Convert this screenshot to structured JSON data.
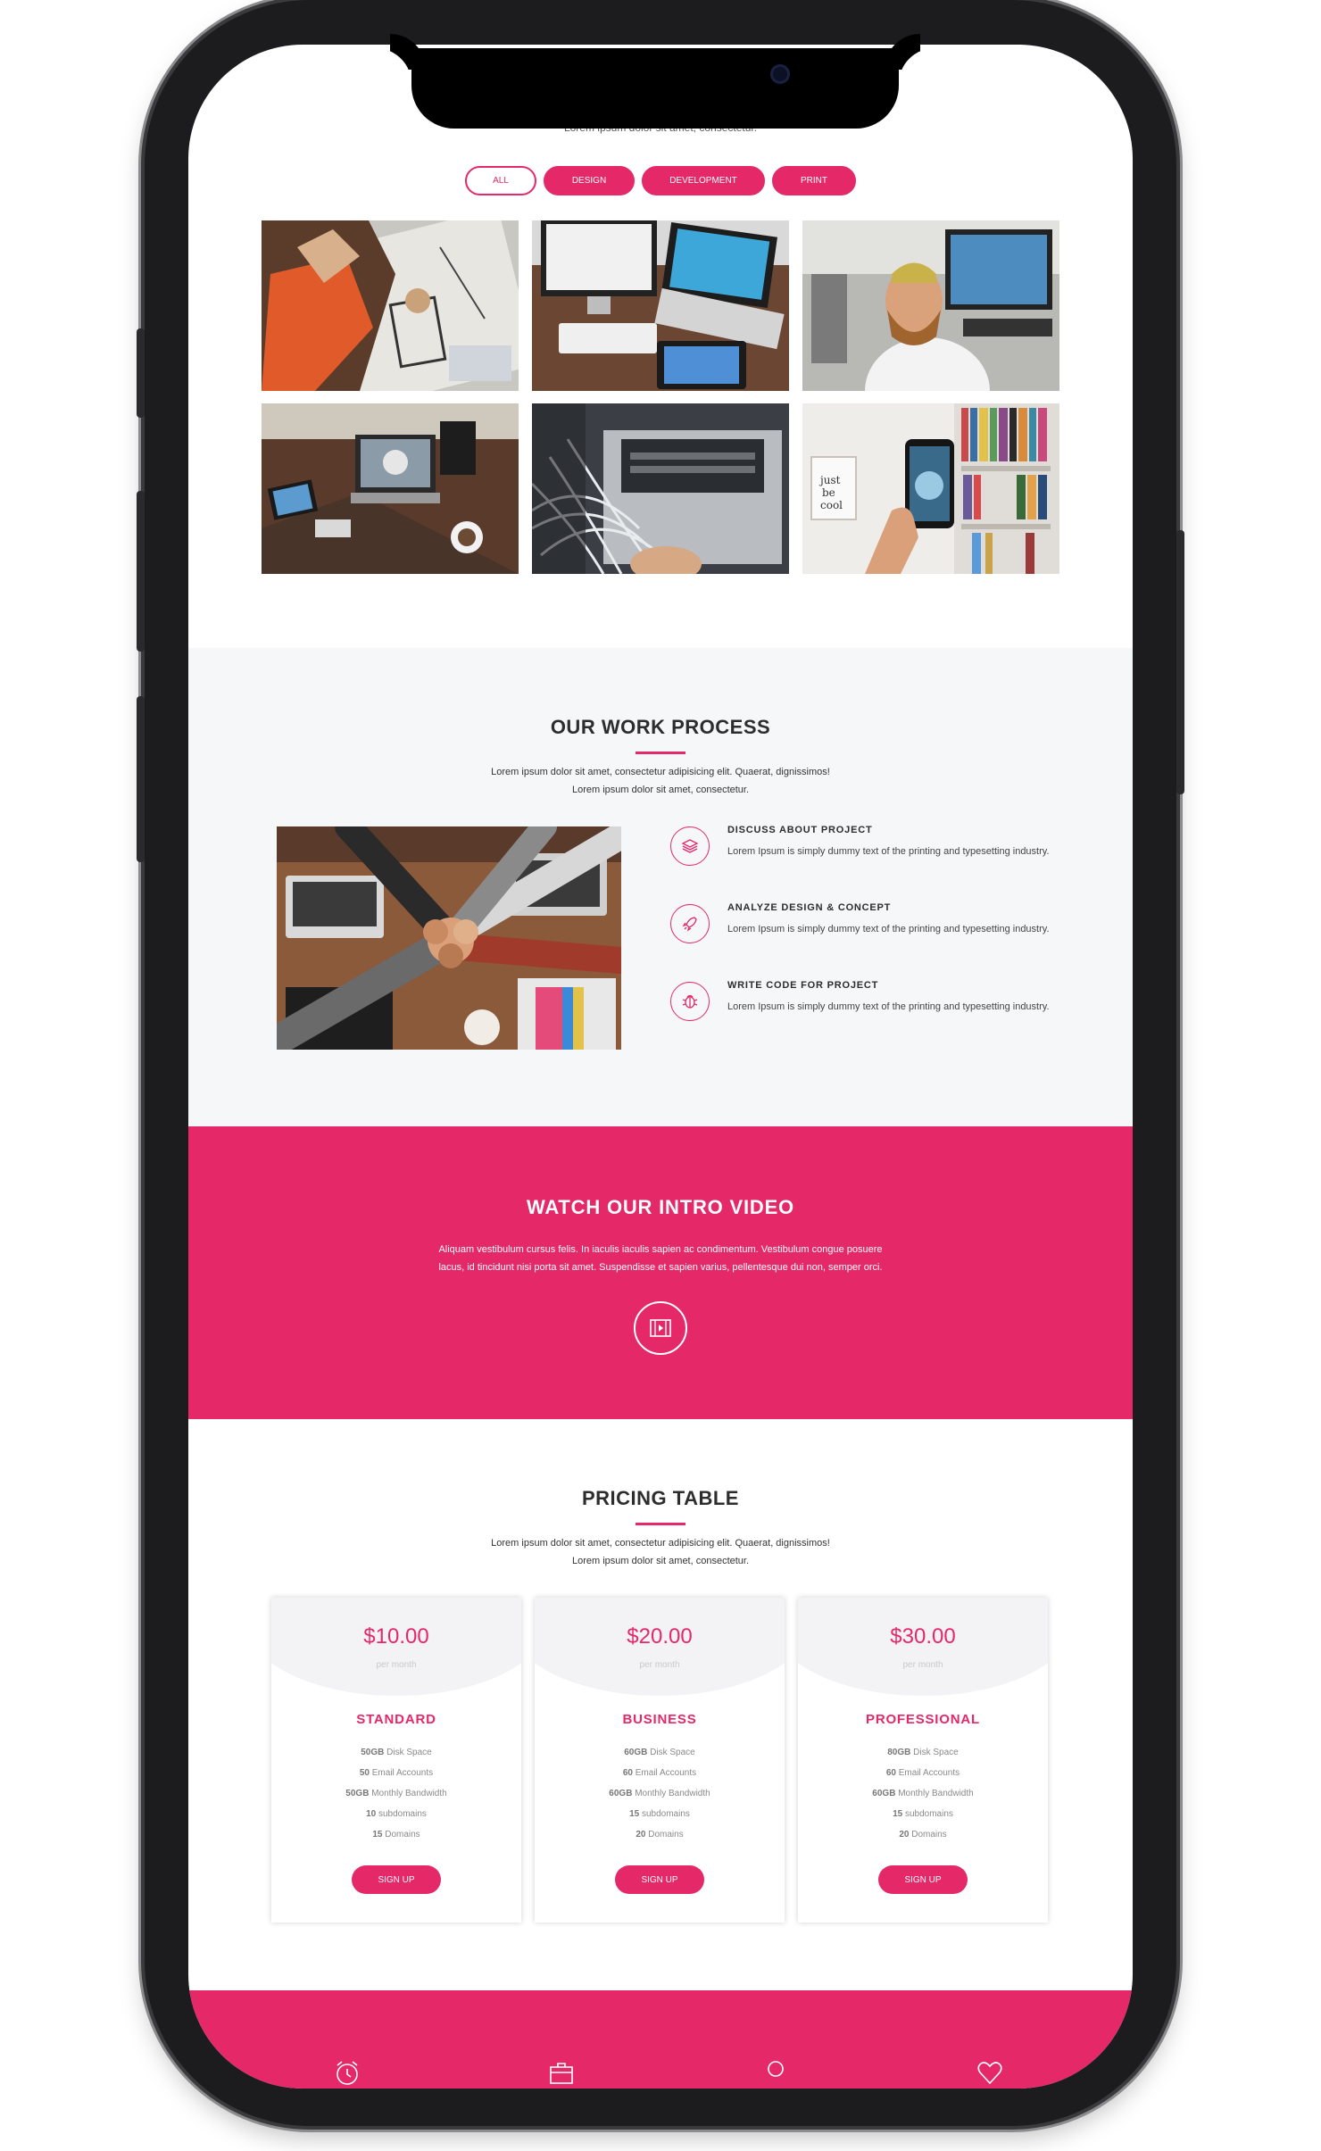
{
  "top": {
    "cut_text": "Lorem ipsum dolor sit amet, consectetur."
  },
  "filters": [
    {
      "label": "ALL",
      "active": true
    },
    {
      "label": "DESIGN",
      "active": false
    },
    {
      "label": "DEVELOPMENT",
      "active": false
    },
    {
      "label": "PRINT",
      "active": false
    }
  ],
  "gallery": [
    "designer-sketching",
    "imac-keyboard-tablet",
    "smiling-man-office",
    "desk-laptop-gadgets",
    "network-cables-server",
    "hand-holding-phone"
  ],
  "process": {
    "title": "OUR WORK PROCESS",
    "lead_line1": "Lorem ipsum dolor sit amet, consectetur adipisicing elit. Quaerat, dignissimos!",
    "lead_line2": "Lorem ipsum dolor sit amet, consectetur.",
    "steps": [
      {
        "icon": "layers-icon",
        "title": "DISCUSS ABOUT PROJECT",
        "desc": "Lorem Ipsum is simply dummy text of the printing and typesetting industry."
      },
      {
        "icon": "rocket-icon",
        "title": "ANALYZE DESIGN & CONCEPT",
        "desc": "Lorem Ipsum is simply dummy text of the printing and typesetting industry."
      },
      {
        "icon": "bug-icon",
        "title": "WRITE CODE FOR PROJECT",
        "desc": "Lorem Ipsum is simply dummy text of the printing and typesetting industry."
      }
    ]
  },
  "video": {
    "title": "WATCH OUR INTRO VIDEO",
    "line1": "Aliquam vestibulum cursus felis. In iaculis iaculis sapien ac condimentum. Vestibulum congue posuere",
    "line2": "lacus, id tincidunt nisi porta sit amet. Suspendisse et sapien varius, pellentesque dui non, semper orci."
  },
  "pricing": {
    "title": "PRICING TABLE",
    "lead_line1": "Lorem ipsum dolor sit amet, consectetur adipisicing elit. Quaerat, dignissimos!",
    "lead_line2": "Lorem ipsum dolor sit amet, consectetur.",
    "per": "per month",
    "signup": "SIGN UP",
    "plans": [
      {
        "price": "$10.00",
        "name": "STANDARD",
        "f1n": "50GB",
        "f1t": "Disk Space",
        "f2n": "50",
        "f2t": "Email Accounts",
        "f3n": "50GB",
        "f3t": "Monthly Bandwidth",
        "f4n": "10",
        "f4t": "subdomains",
        "f5n": "15",
        "f5t": "Domains"
      },
      {
        "price": "$20.00",
        "name": "BUSINESS",
        "f1n": "60GB",
        "f1t": "Disk Space",
        "f2n": "60",
        "f2t": "Email Accounts",
        "f3n": "60GB",
        "f3t": "Monthly Bandwidth",
        "f4n": "15",
        "f4t": "subdomains",
        "f5n": "20",
        "f5t": "Domains"
      },
      {
        "price": "$30.00",
        "name": "PROFESSIONAL",
        "f1n": "80GB",
        "f1t": "Disk Space",
        "f2n": "60",
        "f2t": "Email Accounts",
        "f3n": "60GB",
        "f3t": "Monthly Bandwidth",
        "f4n": "15",
        "f4t": "subdomains",
        "f5n": "20",
        "f5t": "Domains"
      }
    ]
  },
  "footer_icons": [
    "alarm-clock-icon",
    "briefcase-icon",
    "circle-icon",
    "heart-icon"
  ],
  "colors": {
    "accent": "#e42868",
    "light_bg": "#f6f7f9",
    "frame": "#1c1c1e"
  }
}
